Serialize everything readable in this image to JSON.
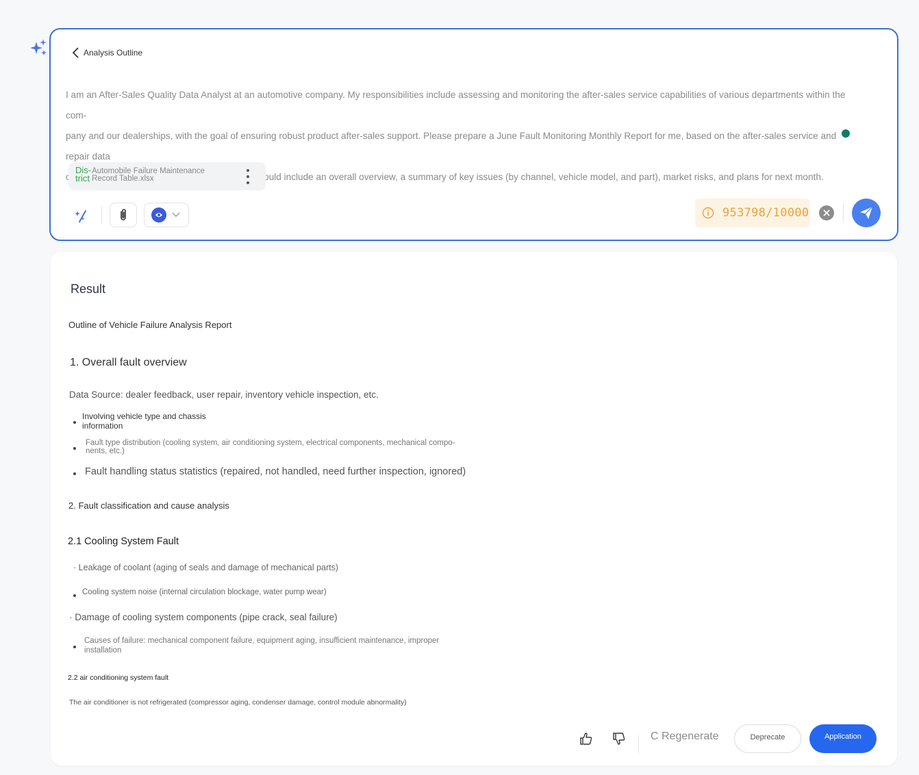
{
  "colors": {
    "accent": "#3b6fe0",
    "send": "#4a7ff0",
    "apply": "#2667f0",
    "counter": "#e8a33c",
    "file_tag": "#2fa84f"
  },
  "header": {
    "back_label": "Analysis Outline"
  },
  "prompt": {
    "lines": [
      "I am an After-Sales Quality Data Analyst at an automotive company. My responsibilities include assessing and monitoring the after-sales service capabilities of various departments within the com-",
      "pany and our dealerships, with the goal of ensuring robust product after-sales support. Please prepare a June Fault Monitoring Monthly Report for me, based on the after-sales service and repair data",
      "collected across various products. The report should include an overall overview, a summary of key issues (by channel, vehicle model, and part), market risks, and plans for next month."
    ]
  },
  "attachment": {
    "tag_line1": "Dis-",
    "tag_line2": "trict",
    "name_line1": "Automobile Failure Maintenance",
    "name_line2": "Record Table.xlsx"
  },
  "toolbar": {
    "char_count": "953798/10000"
  },
  "result": {
    "title": "Result",
    "heading": "Outline of Vehicle Failure Analysis Report",
    "s1_title": "1. Overall fault overview",
    "s1_source": "Data Source: dealer feedback, user repair, inventory vehicle inspection, etc.",
    "s1_b1_l1": "Involving vehicle type and chassis",
    "s1_b1_l2": "information",
    "s1_b2_l1": "Fault type distribution (cooling system, air conditioning system, electrical components, mechanical compo-",
    "s1_b2_l2": "nents, etc.)",
    "s1_b3": "Fault handling status statistics (repaired, not handled, need further inspection, ignored)",
    "s2_title": "2. Fault classification and cause analysis",
    "s21_title": "2.1 Cooling System Fault",
    "s21_i1": "· Leakage of coolant (aging of seals and damage of mechanical parts)",
    "s21_i2": "Cooling system noise (internal circulation blockage, water pump wear)",
    "s21_i3": "· Damage of cooling system components (pipe crack, seal failure)",
    "s21_i4_l1": "Causes of failure: mechanical component failure, equipment aging, insufficient maintenance, improper",
    "s21_i4_l2": "installation",
    "s22_title": "2.2 air conditioning system fault",
    "s22_i1": "The air conditioner is not refrigerated (compressor aging, condenser damage, control module abnormality)"
  },
  "footer": {
    "regenerate": "C Regenerate",
    "deprecate": "Deprecate",
    "application": "Application"
  }
}
